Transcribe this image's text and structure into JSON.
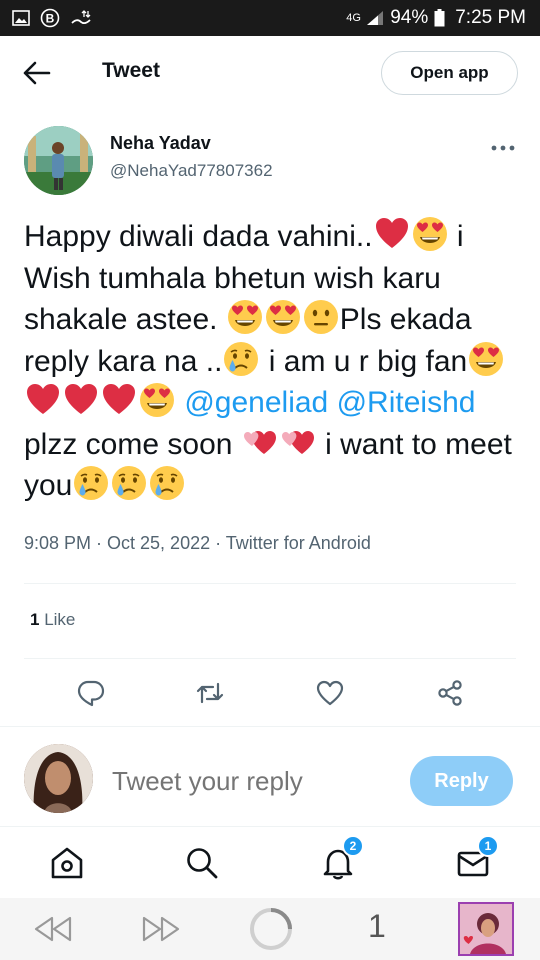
{
  "status_bar": {
    "network": "4G",
    "battery": "94%",
    "time": "7:25 PM"
  },
  "header": {
    "title": "Tweet",
    "open_app_label": "Open app"
  },
  "tweet": {
    "author_name": "Neha Yadav",
    "author_handle": "@NehaYad77807362",
    "text_parts": {
      "p1": "Happy diwali dada vahini..",
      "p2": " i Wish tumhala bhetun wish karu shakale astee. ",
      "p3": "Pls ekada reply kara na ..",
      "p4": " i am u r big fan",
      "p5": " ",
      "mention1": "@geneliad",
      "p6": " ",
      "mention2": "@Riteishd",
      "p7": "  plzz come soon ",
      "p8": " i want to meet you"
    },
    "meta": "9:08 PM · Oct 25, 2022 · Twitter for Android",
    "like_count": "1",
    "like_label": " Like"
  },
  "reply": {
    "placeholder": "Tweet your reply",
    "button_label": "Reply"
  },
  "bottom_nav": {
    "notifications_badge": "2",
    "messages_badge": "1"
  },
  "browser_bar": {
    "tab_count": "1"
  },
  "colors": {
    "accent": "#1d9bf0",
    "reply_button_disabled": "#8ecdf8",
    "text_primary": "#0f1419",
    "text_secondary": "#536471"
  }
}
